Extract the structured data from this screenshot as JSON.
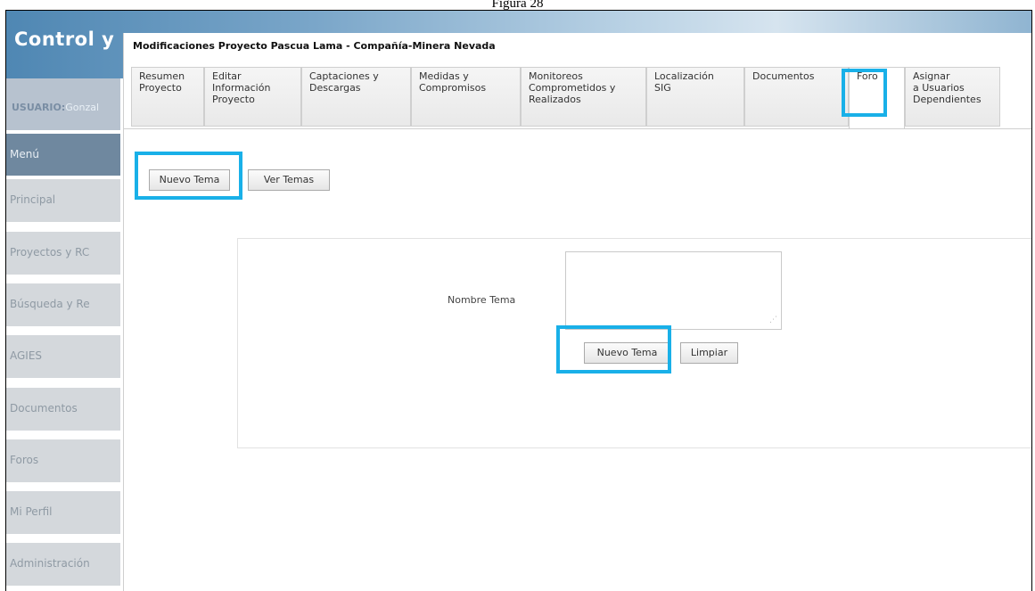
{
  "caption": "Figura 28",
  "app": {
    "title": "Control y"
  },
  "user": {
    "label": "USUARIO:",
    "value": "Gonzal"
  },
  "sidebar": {
    "items": [
      {
        "label": "Menú"
      },
      {
        "label": "Principal"
      },
      {
        "label": "Proyectos y RC"
      },
      {
        "label": "Búsqueda y Re"
      },
      {
        "label": "AGIES"
      },
      {
        "label": "Documentos"
      },
      {
        "label": "Foros"
      },
      {
        "label": "Mi Perfil"
      },
      {
        "label": "Administración"
      }
    ]
  },
  "panel": {
    "title": "Modificaciones Proyecto Pascua Lama - Compañía-Minera Nevada"
  },
  "tabs": [
    {
      "label": "Resumen\nProyecto"
    },
    {
      "label": "Editar\nInformación\nProyecto"
    },
    {
      "label": "Captaciones y\nDescargas"
    },
    {
      "label": "Medidas y\nCompromisos"
    },
    {
      "label": "Monitoreos\nComprometidos y\nRealizados"
    },
    {
      "label": "Localización\nSIG"
    },
    {
      "label": "Documentos"
    },
    {
      "label": "Foro"
    },
    {
      "label": "Asignar\na Usuarios\nDependientes"
    }
  ],
  "actions": {
    "new_topic": "Nuevo Tema",
    "view_topics": "Ver Temas"
  },
  "form": {
    "field_label": "Nombre Tema",
    "field_value": "",
    "submit": "Nuevo Tema",
    "clear": "Limpiar"
  },
  "colors": {
    "highlight": "#19b0e8",
    "menu_header": "#6f889f",
    "menu_item": "#d4d8dc"
  }
}
